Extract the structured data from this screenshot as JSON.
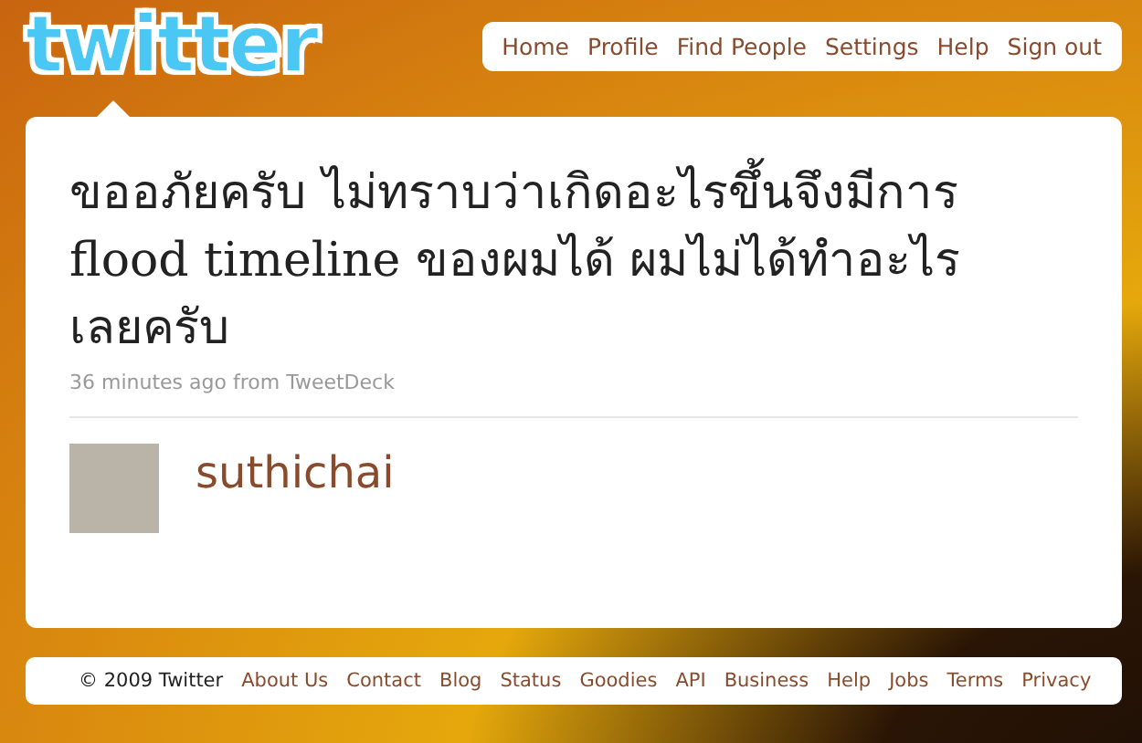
{
  "logo": {
    "text": "twitter"
  },
  "nav": [
    "Home",
    "Profile",
    "Find People",
    "Settings",
    "Help",
    "Sign out"
  ],
  "status": {
    "text": "ขออภัยครับ ไม่ทราบว่าเกิดอะไรขึ้นจึงมีการ flood timeline ของผมได้ ผมไม่ได้ทำอะไรเลยครับ",
    "time": "36 minutes ago",
    "source_prefix": "from",
    "source": "TweetDeck"
  },
  "author": {
    "screen_name": "suthichai"
  },
  "footer": {
    "copyright": "© 2009 Twitter",
    "links": [
      "About Us",
      "Contact",
      "Blog",
      "Status",
      "Goodies",
      "API",
      "Business",
      "Help",
      "Jobs",
      "Terms",
      "Privacy"
    ]
  }
}
